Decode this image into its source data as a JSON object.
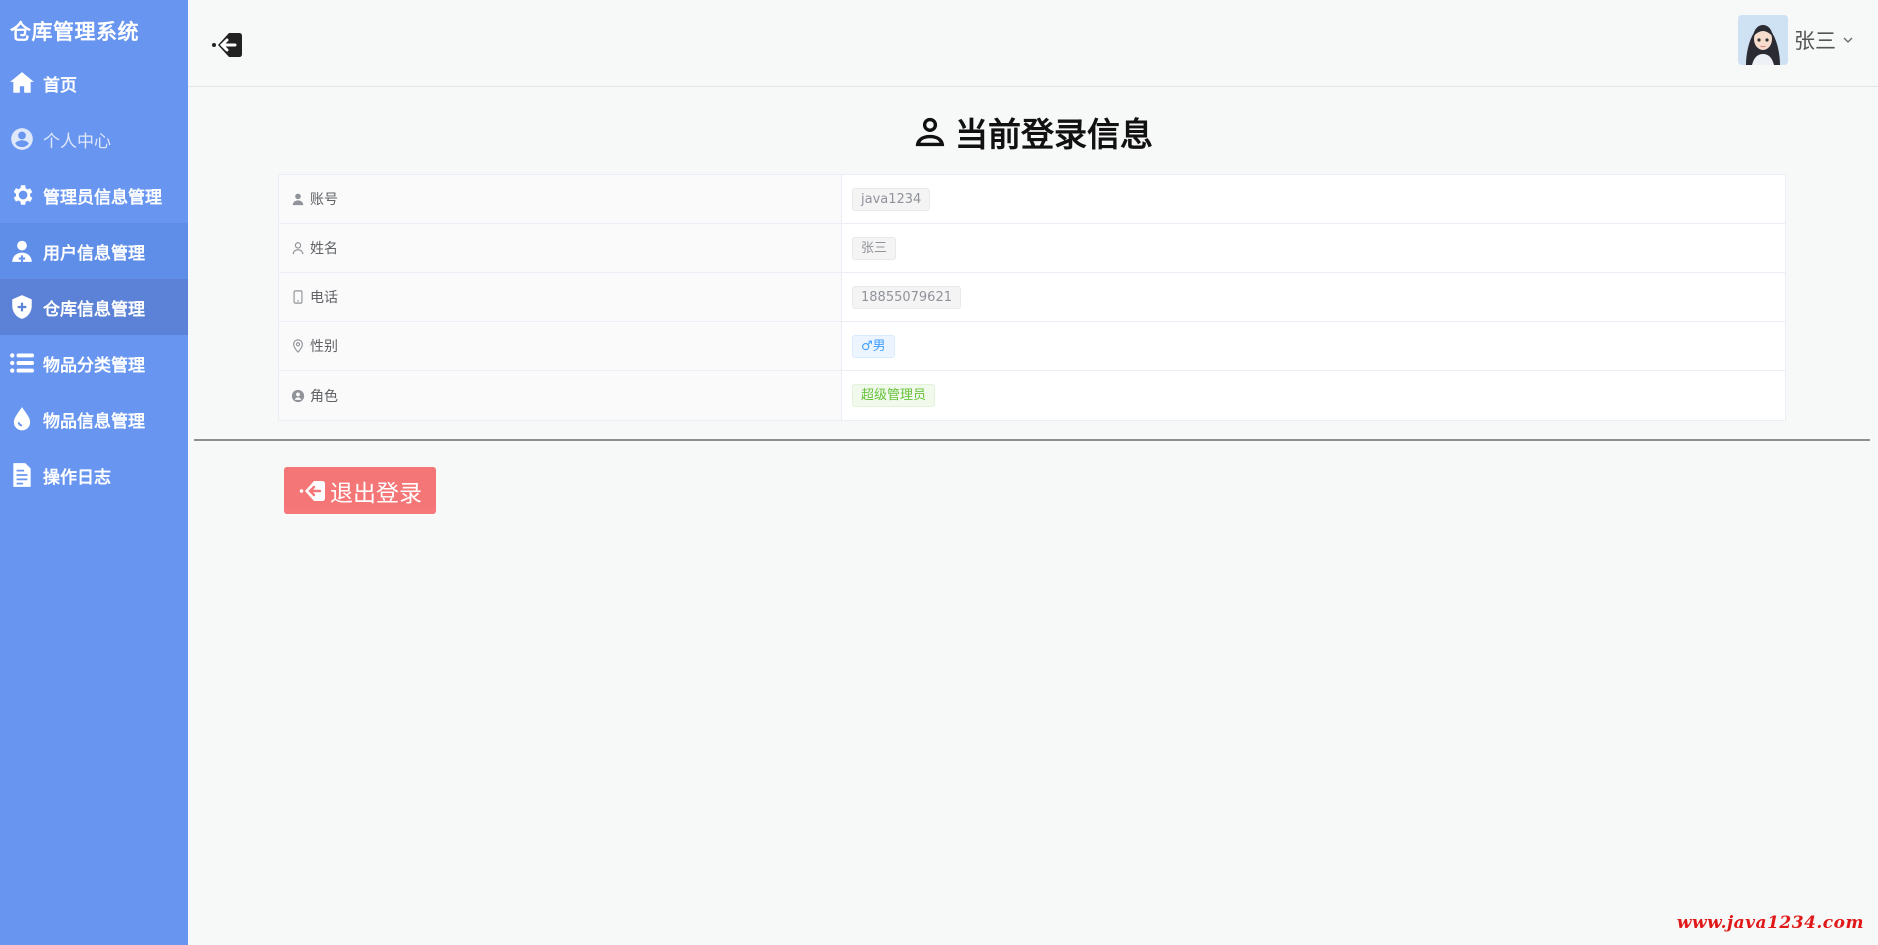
{
  "sidebar": {
    "brand": "仓库管理系统",
    "items": [
      {
        "label": "首页",
        "icon": "home-icon"
      },
      {
        "label": "个人中心",
        "icon": "user-circle-icon"
      },
      {
        "label": "管理员信息管理",
        "icon": "gear-icon"
      },
      {
        "label": "用户信息管理",
        "icon": "user-plus-icon"
      },
      {
        "label": "仓库信息管理",
        "icon": "shield-icon"
      },
      {
        "label": "物品分类管理",
        "icon": "list-icon"
      },
      {
        "label": "物品信息管理",
        "icon": "drop-icon"
      },
      {
        "label": "操作日志",
        "icon": "document-icon"
      }
    ],
    "active_index": 4
  },
  "header": {
    "back_icon": "back-arrow-icon",
    "user_name": "张三"
  },
  "main": {
    "title": "当前登录信息",
    "rows": [
      {
        "label": "账号",
        "value": "java1234",
        "icon": "user-icon"
      },
      {
        "label": "姓名",
        "value": "张三",
        "icon": "user-outline-icon"
      },
      {
        "label": "电话",
        "value": "18855079621",
        "icon": "phone-icon"
      },
      {
        "label": "性别",
        "value": "♂男",
        "icon": "location-icon"
      },
      {
        "label": "角色",
        "value": "超级管理员",
        "icon": "role-icon"
      }
    ],
    "logout_label": "退出登录"
  },
  "watermark": "www.java1234.com",
  "colors": {
    "sidebar": "#6795ef",
    "danger": "#f56c6c",
    "tag_blue": "#409eff",
    "tag_green": "#67c23a"
  }
}
